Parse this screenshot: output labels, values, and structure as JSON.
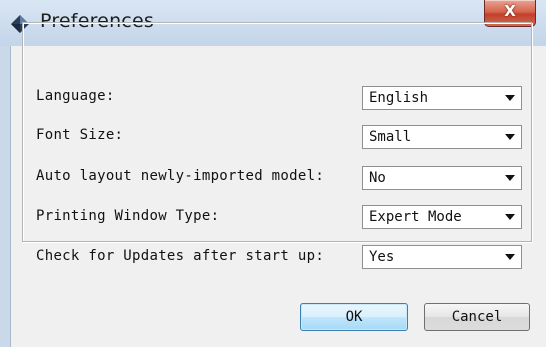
{
  "window": {
    "title": "Preferences",
    "close_label": "X"
  },
  "settings": [
    {
      "label": "Language:",
      "value": "English"
    },
    {
      "label": "Font Size:",
      "value": "Small"
    },
    {
      "label": "Auto layout newly-imported model:",
      "value": "No"
    },
    {
      "label": "Printing Window Type:",
      "value": "Expert Mode"
    },
    {
      "label": "Check for Updates after start up:",
      "value": "Yes"
    }
  ],
  "buttons": {
    "ok_label": "OK",
    "cancel_label": "Cancel"
  },
  "icons": {
    "app": "diamond-app-icon",
    "close": "close-icon",
    "dropdown": "chevron-down-icon"
  },
  "colors": {
    "titlebar": "#c9d9ea",
    "close_button": "#c94a34",
    "ok_accent": "#3c7fb1"
  }
}
